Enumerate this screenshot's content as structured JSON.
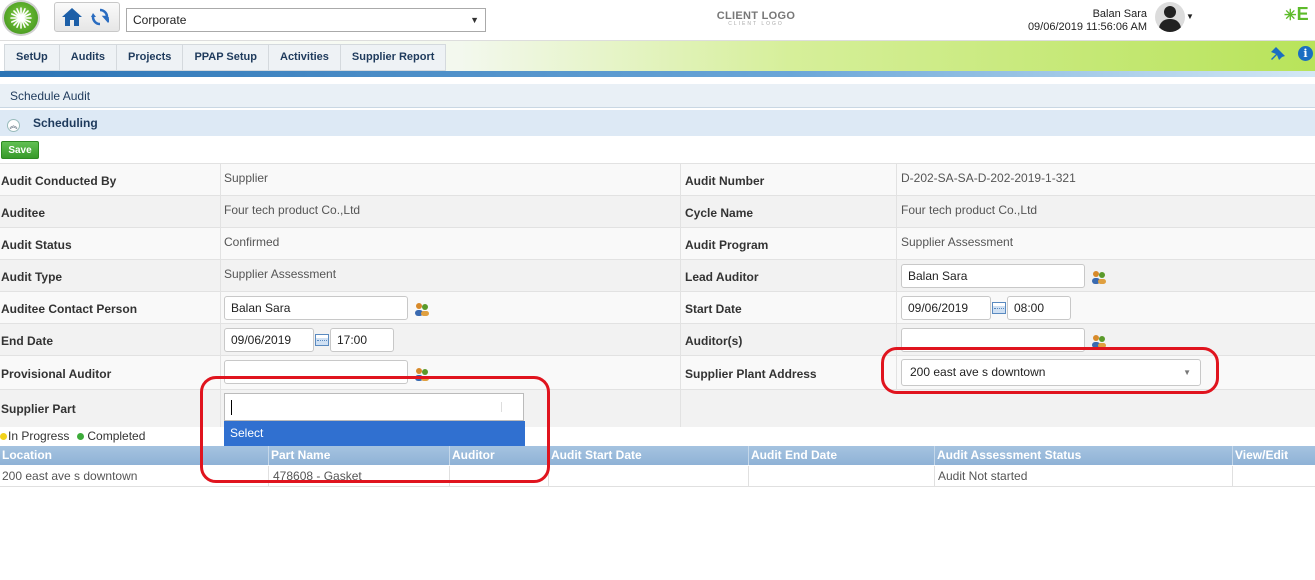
{
  "header": {
    "company": "Corporate",
    "client_logo": "CLIENT LOGO",
    "client_logo_sub": "CLIENT LOGO",
    "user_name": "Balan Sara",
    "datetime": "09/06/2019 11:56:06 AM",
    "brand_letter": "E"
  },
  "menu": {
    "items": [
      "SetUp",
      "Audits",
      "Projects",
      "PPAP Setup",
      "Activities",
      "Supplier Report"
    ]
  },
  "page": {
    "title": "Schedule Audit",
    "section": "Scheduling",
    "save_label": "Save"
  },
  "form": {
    "audit_conducted_by": {
      "label": "Audit Conducted By",
      "value": "Supplier"
    },
    "auditee": {
      "label": "Auditee",
      "value": "Four tech product Co.,Ltd"
    },
    "audit_status": {
      "label": "Audit Status",
      "value": "Confirmed"
    },
    "audit_type": {
      "label": "Audit Type",
      "value": "Supplier Assessment"
    },
    "auditee_contact": {
      "label": "Auditee Contact Person",
      "value": "Balan Sara"
    },
    "end_date": {
      "label": "End Date",
      "date": "09/06/2019",
      "time": "17:00"
    },
    "provisional_auditor": {
      "label": "Provisional Auditor",
      "value": ""
    },
    "supplier_part": {
      "label": "Supplier Part",
      "value": "",
      "option": "Select"
    },
    "audit_number": {
      "label": "Audit Number",
      "value": "D-202-SA-SA-D-202-2019-1-321"
    },
    "cycle_name": {
      "label": "Cycle Name",
      "value": "Four tech product Co.,Ltd"
    },
    "audit_program": {
      "label": "Audit Program",
      "value": "Supplier Assessment"
    },
    "lead_auditor": {
      "label": "Lead Auditor",
      "value": "Balan Sara"
    },
    "start_date": {
      "label": "Start Date",
      "date": "09/06/2019",
      "time": "08:00"
    },
    "auditors": {
      "label": "Auditor(s)",
      "value": ""
    },
    "supplier_plant_address": {
      "label": "Supplier Plant Address",
      "value": "200 east ave s downtown"
    }
  },
  "legend": {
    "in_progress": "In Progress",
    "completed": "Completed",
    "in_progress_color": "#f2d21b",
    "completed_color": "#3dab3a"
  },
  "grid": {
    "columns": [
      "Location",
      "Part Name",
      "Auditor",
      "Audit Start Date",
      "Audit End Date",
      "Audit Assessment Status",
      "View/Edit"
    ],
    "rows": [
      [
        "200 east ave s downtown",
        "478608 - Gasket",
        "",
        "",
        "",
        "Audit Not started",
        ""
      ]
    ]
  }
}
